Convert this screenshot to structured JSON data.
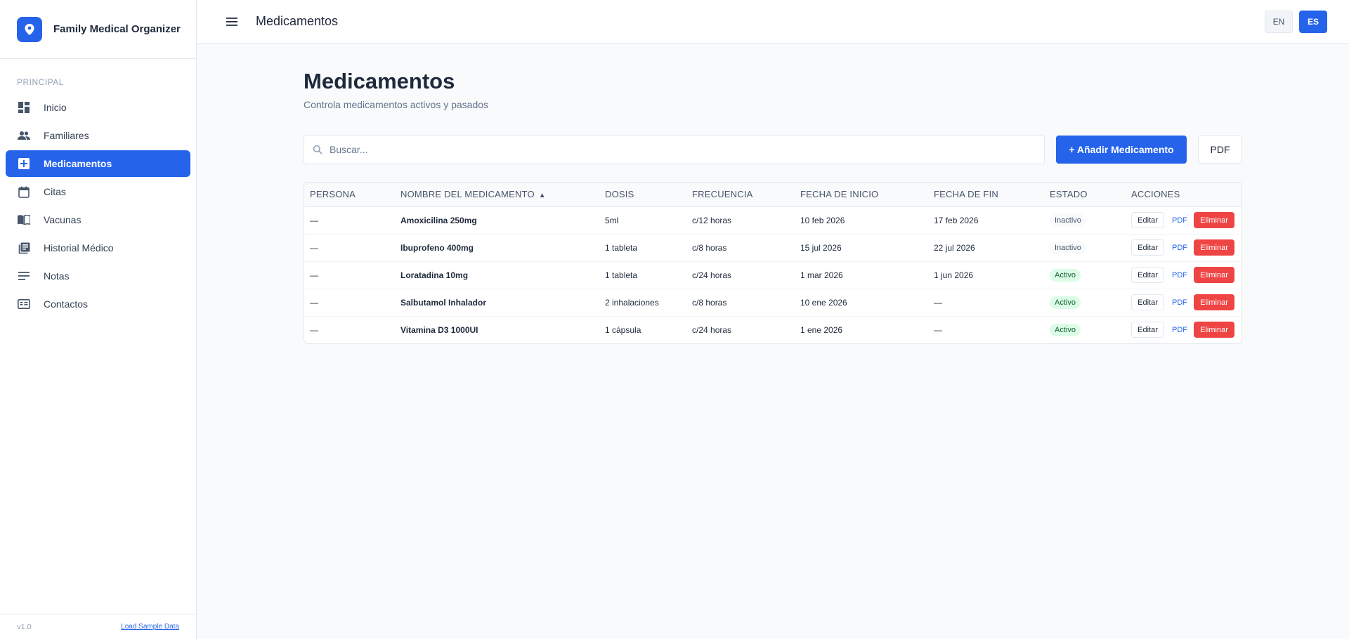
{
  "app": {
    "name": "Family Medical Organizer",
    "version": "v1.0",
    "load_sample": "Load Sample Data"
  },
  "sidebar": {
    "section": "PRINCIPAL",
    "items": [
      {
        "label": "Inicio",
        "icon": "dashboard-icon"
      },
      {
        "label": "Familiares",
        "icon": "people-icon"
      },
      {
        "label": "Medicamentos",
        "icon": "medical-plus-icon",
        "active": true
      },
      {
        "label": "Citas",
        "icon": "calendar-icon"
      },
      {
        "label": "Vacunas",
        "icon": "book-icon"
      },
      {
        "label": "Historial Médico",
        "icon": "history-icon"
      },
      {
        "label": "Notas",
        "icon": "notes-icon"
      },
      {
        "label": "Contactos",
        "icon": "contacts-icon"
      }
    ]
  },
  "header": {
    "title": "Medicamentos",
    "lang_en": "EN",
    "lang_es": "ES",
    "active_lang": "ES"
  },
  "main": {
    "title": "Medicamentos",
    "subtitle": "Controla medicamentos activos y pasados",
    "search_placeholder": "Buscar...",
    "add_button": "+ Añadir Medicamento",
    "pdf_button": "PDF"
  },
  "table": {
    "columns": [
      "PERSONA",
      "NOMBRE DEL MEDICAMENTO",
      "DOSIS",
      "FRECUENCIA",
      "FECHA DE INICIO",
      "FECHA DE FIN",
      "ESTADO",
      "ACCIONES"
    ],
    "sort_indicator": "▲",
    "actions": {
      "edit": "Editar",
      "pdf": "PDF",
      "delete": "Eliminar"
    },
    "rows": [
      {
        "persona": "—",
        "name": "Amoxicilina 250mg",
        "dose": "5ml",
        "freq": "c/12 horas",
        "start": "10 feb 2026",
        "end": "17 feb 2026",
        "status": "Inactivo",
        "status_type": "inactive"
      },
      {
        "persona": "—",
        "name": "Ibuprofeno 400mg",
        "dose": "1 tableta",
        "freq": "c/8 horas",
        "start": "15 jul 2026",
        "end": "22 jul 2026",
        "status": "Inactivo",
        "status_type": "inactive"
      },
      {
        "persona": "—",
        "name": "Loratadina 10mg",
        "dose": "1 tableta",
        "freq": "c/24 horas",
        "start": "1 mar 2026",
        "end": "1 jun 2026",
        "status": "Activo",
        "status_type": "active"
      },
      {
        "persona": "—",
        "name": "Salbutamol Inhalador",
        "dose": "2 inhalaciones",
        "freq": "c/8 horas",
        "start": "10 ene 2026",
        "end": "—",
        "status": "Activo",
        "status_type": "active"
      },
      {
        "persona": "—",
        "name": "Vitamina D3 1000UI",
        "dose": "1 cápsula",
        "freq": "c/24 horas",
        "start": "1 ene 2026",
        "end": "—",
        "status": "Activo",
        "status_type": "active"
      }
    ]
  },
  "colors": {
    "primary": "#2563eb",
    "danger": "#ef4444",
    "active_badge": "#dcfce7"
  }
}
